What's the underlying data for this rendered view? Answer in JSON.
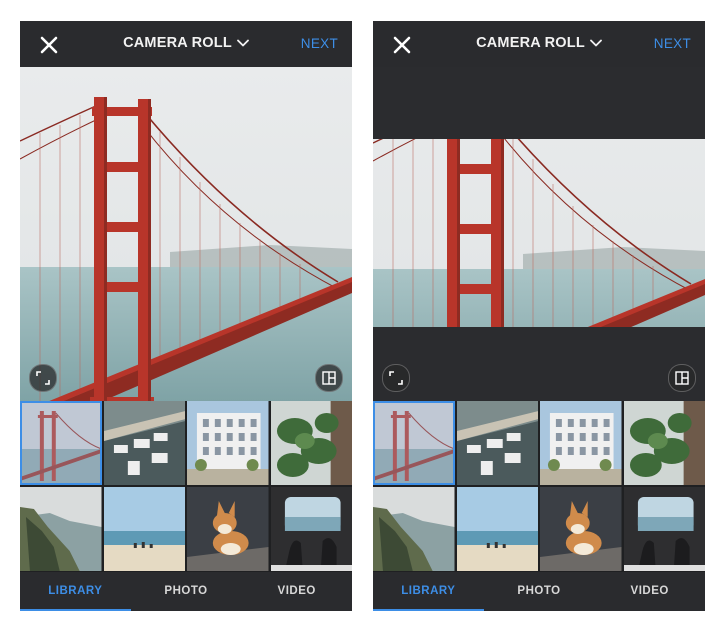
{
  "screens": [
    {
      "header": {
        "title": "CAMERA ROLL",
        "next_label": "NEXT"
      },
      "preview": {
        "mode": "fill"
      },
      "tabs": [
        {
          "label": "LIBRARY",
          "active": true
        },
        {
          "label": "PHOTO",
          "active": false
        },
        {
          "label": "VIDEO",
          "active": false
        }
      ]
    },
    {
      "header": {
        "title": "CAMERA ROLL",
        "next_label": "NEXT"
      },
      "preview": {
        "mode": "fit"
      },
      "tabs": [
        {
          "label": "LIBRARY",
          "active": true
        },
        {
          "label": "PHOTO",
          "active": false
        },
        {
          "label": "VIDEO",
          "active": false
        }
      ]
    }
  ],
  "thumbnails": [
    "golden-gate-bridge",
    "marina-boats",
    "white-building",
    "monstera-plant",
    "coastal-cliffs",
    "beach",
    "corgi-dog",
    "window-view"
  ],
  "icons": {
    "close": "close-icon",
    "dropdown": "chevron-down-icon",
    "expand": "expand-icon",
    "layout": "layout-icon"
  },
  "colors": {
    "accent": "#3d8ee6",
    "bar": "#2a2b2e",
    "bridge": "#b8352a"
  }
}
